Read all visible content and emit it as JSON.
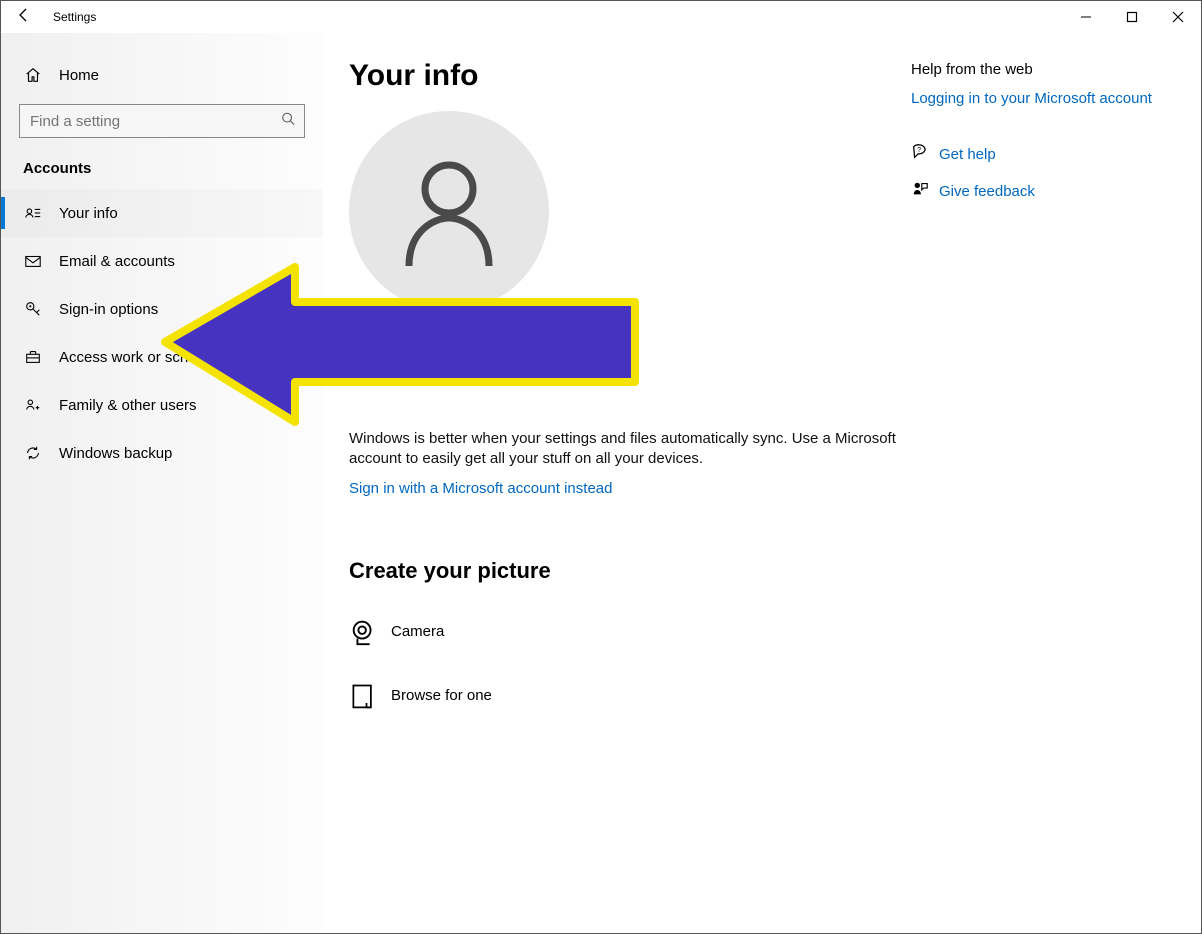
{
  "window": {
    "title": "Settings"
  },
  "sidebar": {
    "home": "Home",
    "search_placeholder": "Find a setting",
    "section": "Accounts",
    "items": [
      {
        "label": "Your info"
      },
      {
        "label": "Email & accounts"
      },
      {
        "label": "Sign-in options"
      },
      {
        "label": "Access work or school"
      },
      {
        "label": "Family & other users"
      },
      {
        "label": "Windows backup"
      }
    ]
  },
  "main": {
    "title": "Your info",
    "desc": "Windows is better when your settings and files automatically sync. Use a Microsoft account to easily get all your stuff on all your devices.",
    "signin_link": "Sign in with a Microsoft account instead",
    "create_picture": "Create your picture",
    "camera": "Camera",
    "browse": "Browse for one"
  },
  "right": {
    "help_title": "Help from the web",
    "login_link": "Logging in to your Microsoft account",
    "get_help": "Get help",
    "feedback": "Give feedback"
  },
  "annotation": {
    "arrow_color_fill": "#4633C0",
    "arrow_color_stroke": "#F4E300"
  }
}
